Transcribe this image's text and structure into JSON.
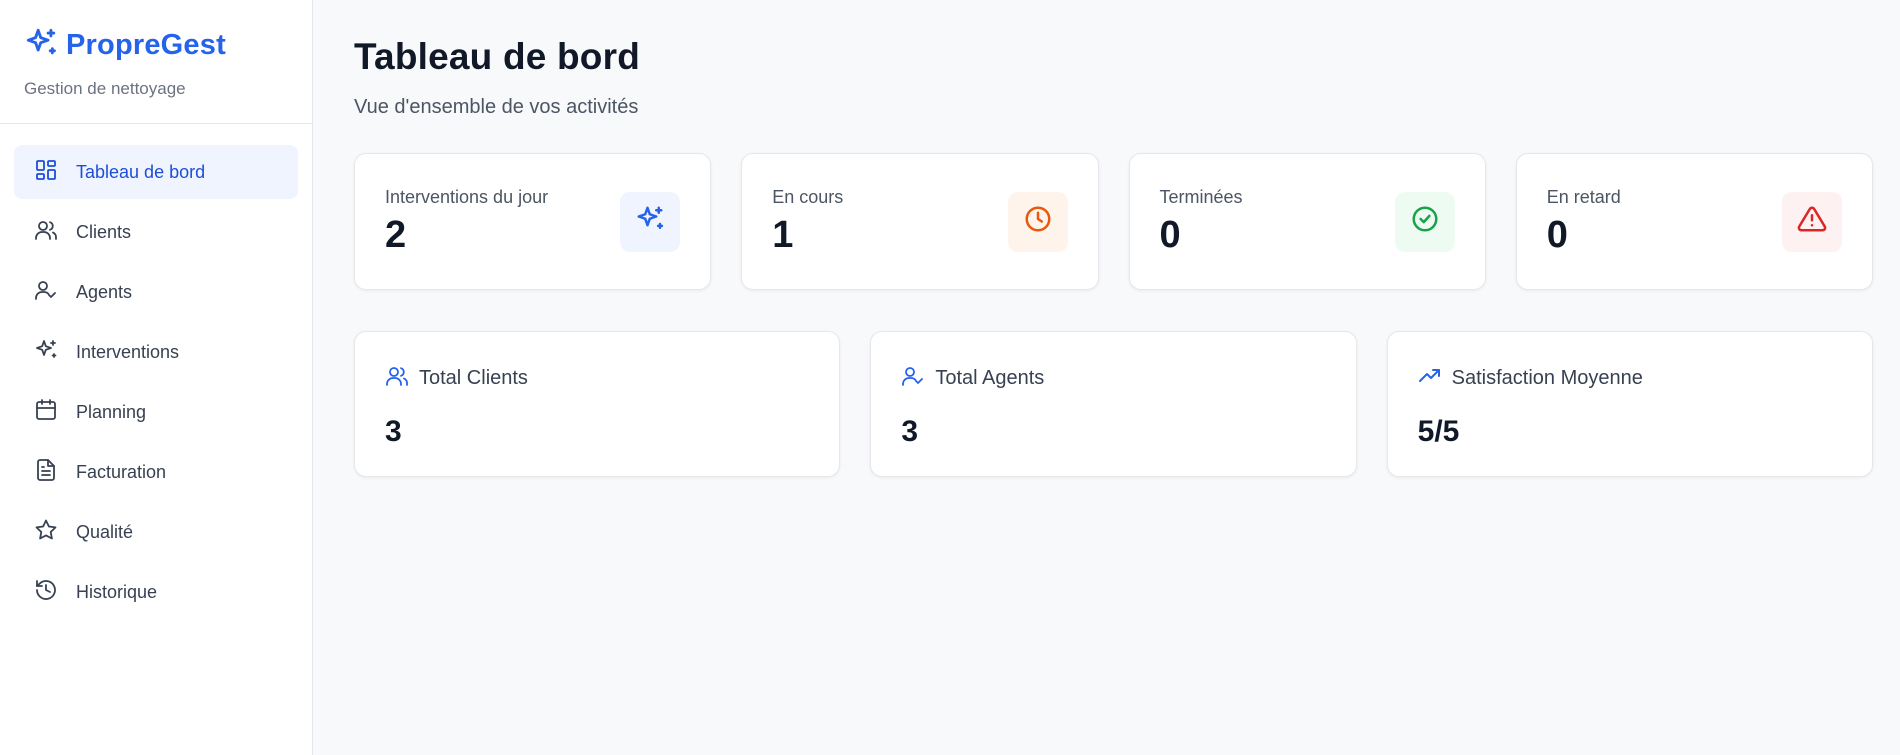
{
  "brand": {
    "title": "PropreGest",
    "subtitle": "Gestion de nettoyage",
    "icon": "sparkles-icon",
    "color": "#2563eb"
  },
  "nav": {
    "items": [
      {
        "label": "Tableau de bord",
        "icon": "dashboard-icon",
        "active": true
      },
      {
        "label": "Clients",
        "icon": "users-icon"
      },
      {
        "label": "Agents",
        "icon": "user-check-icon"
      },
      {
        "label": "Interventions",
        "icon": "sparkles-icon"
      },
      {
        "label": "Planning",
        "icon": "calendar-icon"
      },
      {
        "label": "Facturation",
        "icon": "file-text-icon"
      },
      {
        "label": "Qualité",
        "icon": "star-icon"
      },
      {
        "label": "Historique",
        "icon": "history-icon"
      }
    ]
  },
  "page": {
    "title": "Tableau de bord",
    "subtitle": "Vue d'ensemble de vos activités"
  },
  "stats": [
    {
      "label": "Interventions du jour",
      "value": "2",
      "icon": "sparkles-icon",
      "color": "#2563eb",
      "bg": "#eff4ff"
    },
    {
      "label": "En cours",
      "value": "1",
      "icon": "clock-icon",
      "color": "#ea580c",
      "bg": "#fff4ec"
    },
    {
      "label": "Terminées",
      "value": "0",
      "icon": "check-circle-icon",
      "color": "#16a34a",
      "bg": "#eefbf2"
    },
    {
      "label": "En retard",
      "value": "0",
      "icon": "alert-triangle-icon",
      "color": "#dc2626",
      "bg": "#fef1f1"
    }
  ],
  "totals": [
    {
      "label": "Total Clients",
      "value": "3",
      "icon": "users-icon",
      "color": "#2563eb"
    },
    {
      "label": "Total Agents",
      "value": "3",
      "icon": "user-check-icon",
      "color": "#2563eb"
    },
    {
      "label": "Satisfaction Moyenne",
      "value": "5/5",
      "icon": "trending-up-icon",
      "color": "#2563eb"
    }
  ]
}
